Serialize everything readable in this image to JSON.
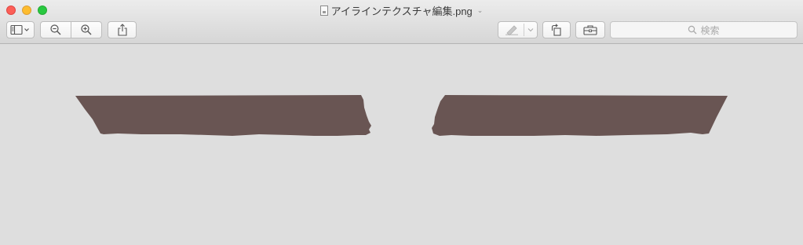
{
  "window": {
    "title": "アイラインテクスチャ編集.png"
  },
  "toolbar": {
    "buttons": [
      {
        "name": "sidebar-toggle",
        "icon": "sidebar-icon"
      },
      {
        "name": "zoom-out",
        "icon": "zoom-out-icon"
      },
      {
        "name": "zoom-in",
        "icon": "zoom-in-icon"
      },
      {
        "name": "share",
        "icon": "share-icon"
      },
      {
        "name": "markup",
        "icon": "pen-icon"
      },
      {
        "name": "rotate",
        "icon": "rotate-left-icon"
      },
      {
        "name": "toolbox",
        "icon": "toolbox-icon"
      }
    ]
  },
  "search": {
    "placeholder": "検索"
  },
  "colors": {
    "eyeline_fill": "#695553",
    "highlight_stroke": "#c49c9b",
    "canvas_background": "#dedede"
  }
}
